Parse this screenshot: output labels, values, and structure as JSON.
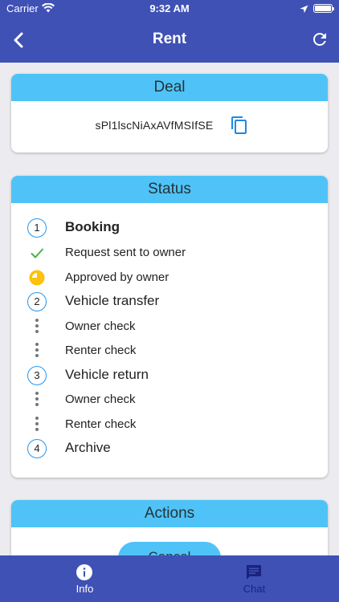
{
  "status_bar": {
    "carrier": "Carrier",
    "time": "9:32 AM"
  },
  "header": {
    "title": "Rent"
  },
  "deal": {
    "title": "Deal",
    "id": "sPl1lscNiAxAVfMSIfSE"
  },
  "status": {
    "title": "Status",
    "steps": [
      {
        "marker": "1",
        "label": "Booking"
      },
      {
        "icon": "check-icon",
        "label": "Request sent to owner"
      },
      {
        "icon": "clock-icon",
        "label": "Approved by owner"
      },
      {
        "marker": "2",
        "label": "Vehicle transfer"
      },
      {
        "icon": "dots-icon",
        "label": "Owner check"
      },
      {
        "icon": "dots-icon",
        "label": "Renter check"
      },
      {
        "marker": "3",
        "label": "Vehicle return"
      },
      {
        "icon": "dots-icon",
        "label": "Owner check"
      },
      {
        "icon": "dots-icon",
        "label": "Renter check"
      },
      {
        "marker": "4",
        "label": "Archive"
      }
    ]
  },
  "actions": {
    "title": "Actions",
    "cancel_label": "Cancel"
  },
  "bottom_nav": {
    "info_label": "Info",
    "chat_label": "Chat"
  },
  "colors": {
    "primary": "#3f51b5",
    "header_accent": "#4fc3f7",
    "check": "#4caf50",
    "pending": "#ffc107",
    "step_ring": "#2196f3",
    "inactive_tab": "#1a237e"
  }
}
